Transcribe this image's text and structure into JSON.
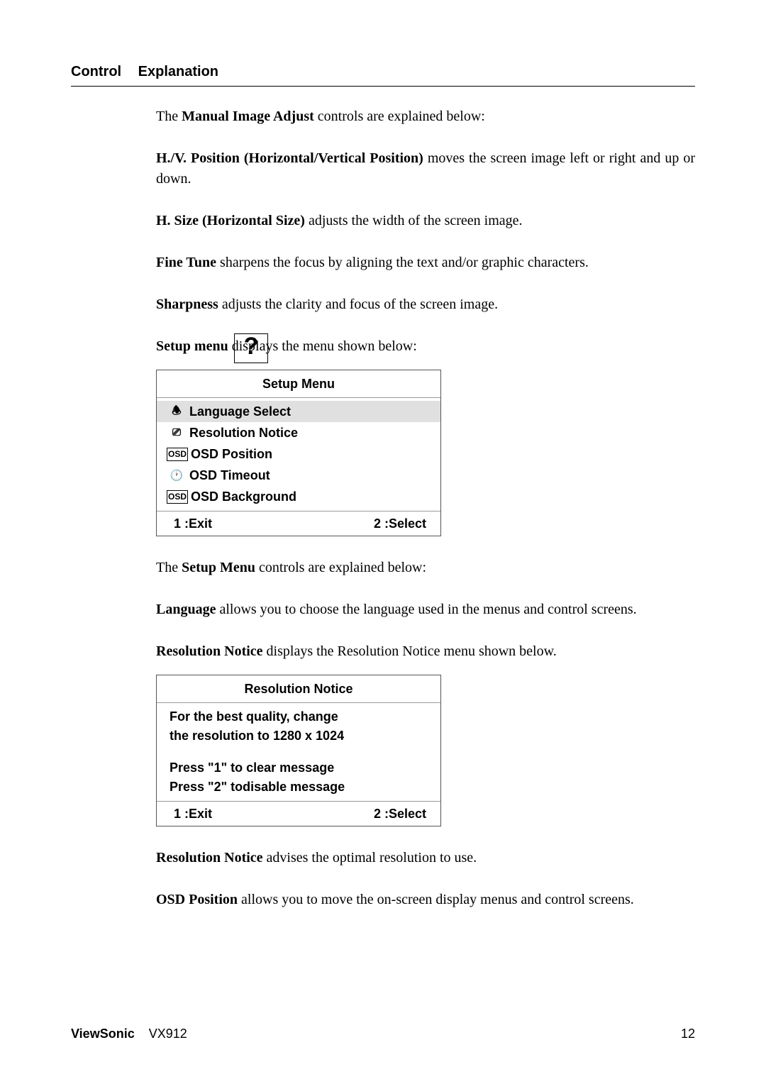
{
  "header": {
    "col1": "Control",
    "col2": "Explanation"
  },
  "p1": {
    "a": "The ",
    "b": "Manual Image Adjust",
    "c": " controls are explained below:"
  },
  "p2": {
    "b": "H./V. Position (Horizontal/Vertical Position)",
    "c": " moves the screen image left or right and up or down."
  },
  "p3": {
    "b": "H. Size (Horizontal Size)",
    "c": " adjusts the width of the screen image."
  },
  "p4": {
    "b": "Fine Tune",
    "c": " sharpens the focus by aligning the text and/or graphic characters."
  },
  "p5": {
    "b": "Sharpness",
    "c": " adjusts the clarity and focus of the screen image."
  },
  "p6": {
    "b": "Setup menu",
    "c": " displays the menu shown below:"
  },
  "icon": {
    "question": "?"
  },
  "setup_menu": {
    "title": "Setup Menu",
    "items": [
      {
        "icon": "🕭",
        "label": "Language Select"
      },
      {
        "icon": "⎚",
        "label": "Resolution Notice"
      },
      {
        "icon": "OSD",
        "label": "OSD Position"
      },
      {
        "icon": "🕐",
        "label": "OSD Timeout"
      },
      {
        "icon": "OSD",
        "label": "OSD Background"
      }
    ],
    "footer_left": "1 :Exit",
    "footer_right": "2 :Select"
  },
  "p7": {
    "a": "The ",
    "b": "Setup Menu",
    "c": " controls are explained below:"
  },
  "p8": {
    "b": "Language",
    "c": " allows you to choose the language used in the menus and control screens."
  },
  "p9": {
    "b": "Resolution Notice",
    "c": " displays the Resolution Notice menu shown below."
  },
  "res_notice": {
    "title": "Resolution Notice",
    "l1": "For the best quality, change",
    "l2": "the resolution to 1280 x 1024",
    "l3": "Press \"1\" to clear message",
    "l4": "Press \"2\" todisable message",
    "footer_left": "1 :Exit",
    "footer_right": "2 :Select"
  },
  "p10": {
    "b": "Resolution Notice",
    "c": " advises the optimal resolution to use."
  },
  "p11": {
    "b": "OSD Position",
    "c": " allows you to move the on-screen display menus and control screens."
  },
  "footer": {
    "brand": "ViewSonic",
    "model": "VX912",
    "page": "12"
  }
}
